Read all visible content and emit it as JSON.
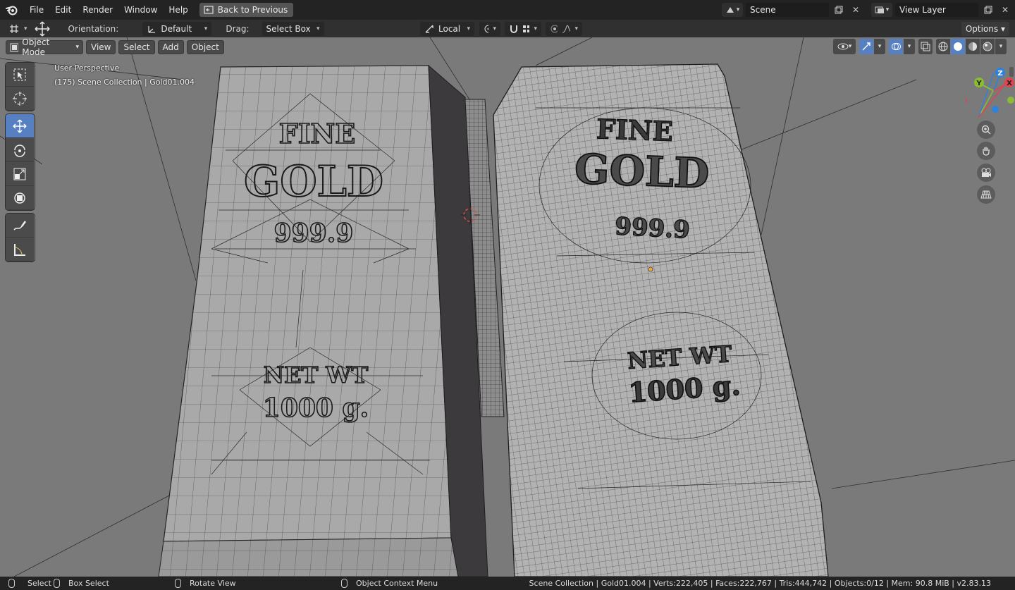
{
  "menubar": {
    "items": [
      "File",
      "Edit",
      "Render",
      "Window",
      "Help"
    ],
    "back_button": "Back to Previous",
    "scene_name": "Scene",
    "view_layer_name": "View Layer"
  },
  "tool_settings": {
    "orientation_label": "Orientation:",
    "orientation_value": "Default",
    "drag_label": "Drag:",
    "drag_value": "Select Box",
    "pivot_value": "Local",
    "options_label": "Options"
  },
  "viewport_header": {
    "mode": "Object Mode",
    "menus": [
      "View",
      "Select",
      "Add",
      "Object"
    ]
  },
  "viewport_info": {
    "line1": "User Perspective",
    "line2": "(175) Scene Collection | Gold01.004"
  },
  "gizmo_axes": {
    "y": "Y",
    "z": "Z",
    "x": "X"
  },
  "left_bar_text": {
    "fine": "FINE",
    "gold": "GOLD",
    "purity": "999.9",
    "net": "NET WT",
    "weight": "1000 g."
  },
  "right_bar_text": {
    "fine": "FINE",
    "gold": "GOLD",
    "purity": "999.9",
    "net": "NET WT",
    "weight": "1000 g."
  },
  "statusbar": {
    "select": "Select",
    "box_select": "Box Select",
    "rotate_view": "Rotate View",
    "context_menu": "Object Context Menu",
    "stats": "Scene Collection | Gold01.004 | Verts:222,405 | Faces:222,767 | Tris:444,742 | Objects:0/12 | Mem: 90.8 MiB | v2.83.13"
  },
  "colors": {
    "viewport_bg": "#7a7a7a",
    "accent": "#5680c2",
    "axis_x": "#e0454f",
    "axis_y": "#8bbb35",
    "axis_z": "#2f82db"
  }
}
